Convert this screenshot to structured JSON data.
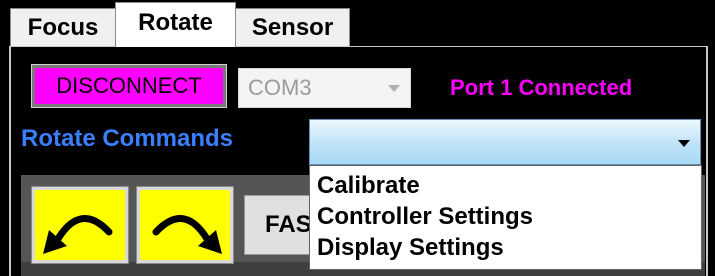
{
  "tabs": [
    {
      "label": "Focus",
      "active": false
    },
    {
      "label": "Rotate",
      "active": true
    },
    {
      "label": "Sensor",
      "active": false
    }
  ],
  "connection": {
    "disconnect_label": "DISCONNECT",
    "port_value": "COM3",
    "status_text": "Port 1 Connected"
  },
  "rotate_commands": {
    "label": "Rotate Commands",
    "selected_value": "",
    "options": [
      "Calibrate",
      "Controller Settings",
      "Display Settings"
    ]
  },
  "controls": {
    "rotate_ccw_icon": "arrow-ccw-icon",
    "rotate_cw_icon": "arrow-cw-icon",
    "fast_label": "FAST"
  },
  "colors": {
    "disconnect_bg": "#ff00ff",
    "status_text": "#ff00ff",
    "commands_label": "#3a7fff",
    "rotate_button_bg": "#ffff00"
  }
}
